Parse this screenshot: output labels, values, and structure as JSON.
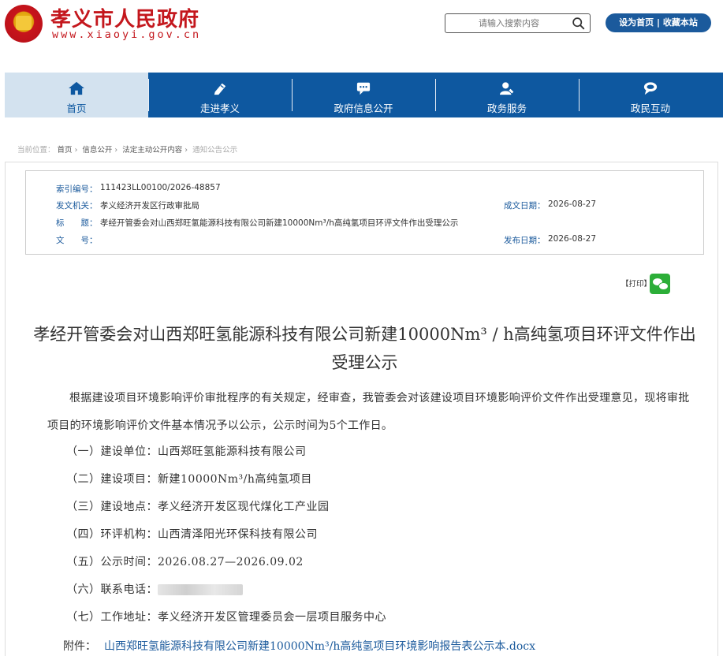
{
  "site": {
    "title": "孝义市人民政府",
    "url": "www.xiaoyi.gov.cn"
  },
  "search": {
    "placeholder": "请输入搜索内容",
    "icon": "search-icon"
  },
  "top_links": {
    "label": "设为首页 | 收藏本站"
  },
  "nav": {
    "items": [
      {
        "label": "首页",
        "icon": "home-icon"
      },
      {
        "label": "走进孝义",
        "icon": "pencil-icon"
      },
      {
        "label": "政府信息公开",
        "icon": "chat-icon"
      },
      {
        "label": "政务服务",
        "icon": "user-icon"
      },
      {
        "label": "政民互动",
        "icon": "speech-icon"
      }
    ]
  },
  "breadcrumb": {
    "prefix": "当前位置：",
    "items": [
      "首页",
      "信息公开",
      "法定主动公开内容",
      "通知公告公示"
    ]
  },
  "meta": {
    "index_label": "索引编号：",
    "index_value": "111423LL00100/2026-48857",
    "issuer_label": "发文机关：",
    "issuer_value": "孝义经济开发区行政审批局",
    "title_label": "标　　题：",
    "title_value": "孝经开管委会对山西郑旺氢能源科技有限公司新建10000Nm³/h高纯氢项目环评文件作出受理公示",
    "docno_label": "文　　号：",
    "docno_value": "",
    "created_label": "成文日期：",
    "created_value": "2026-08-27",
    "published_label": "发布日期：",
    "published_value": "2026-08-27"
  },
  "print_label": "【打印】",
  "article": {
    "title": "孝经开管委会对山西郑旺氢能源科技有限公司新建10000Nm³ / h高纯氢项目环评文件作出受理公示",
    "intro": "根据建设项目环境影响评价审批程序的有关规定，经审查，我管委会对该建设项目环境影响评价文件作出受理意见，现将审批项目的环境影响评价文件基本情况予以公示，公示时间为5个工作日。",
    "items": [
      "（一）建设单位：山西郑旺氢能源科技有限公司",
      "（二）建设项目：新建10000Nm³/h高纯氢项目",
      "（三）建设地点：孝义经济开发区现代煤化工产业园",
      "（四）环评机构：山西清泽阳光环保科技有限公司",
      "（五）公示时间：2026.08.27—2026.09.02",
      "（六）联系电话：",
      "（七）工作地址：孝义经济开发区管理委员会一层项目服务中心"
    ],
    "attachment_label": "附件：",
    "attachment_name": "山西郑旺氢能源科技有限公司新建10000Nm³/h高纯氢项目环境影响报告表公示本.docx"
  },
  "colors": {
    "brand_red": "#c4171d",
    "nav_blue": "#0e58a0",
    "link_blue": "#1b5a9c"
  }
}
